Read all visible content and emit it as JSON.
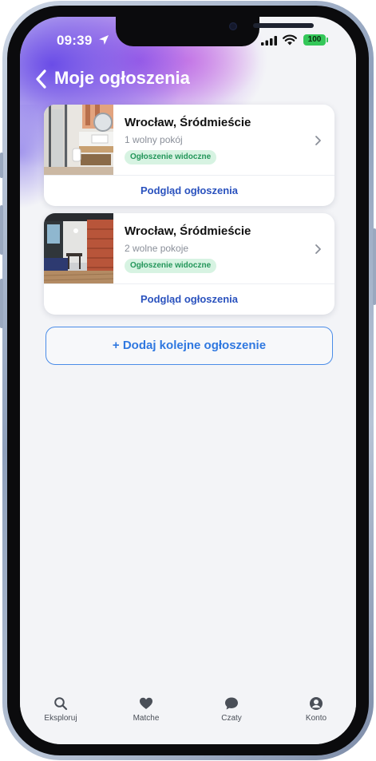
{
  "status_bar": {
    "time": "09:39",
    "battery": "100",
    "icons": [
      "location-arrow-icon",
      "signal-icon",
      "wifi-icon",
      "battery-icon"
    ]
  },
  "header": {
    "back_icon": "chevron-left-icon",
    "title": "Moje ogłoszenia"
  },
  "listings": [
    {
      "city": "Wrocław, Śródmieście",
      "rooms": "1 wolny pokój",
      "status": "Ogłoszenie widoczne",
      "preview": "Podgląd ogłoszenia"
    },
    {
      "city": "Wrocław, Śródmieście",
      "rooms": "2 wolne pokoje",
      "status": "Ogłoszenie widoczne",
      "preview": "Podgląd ogłoszenia"
    }
  ],
  "add_button": "+ Dodaj kolejne ogłoszenie",
  "tabs": [
    {
      "label": "Eksploruj",
      "icon": "search-icon"
    },
    {
      "label": "Matche",
      "icon": "heart-icon"
    },
    {
      "label": "Czaty",
      "icon": "chat-bubble-icon"
    },
    {
      "label": "Konto",
      "icon": "account-icon"
    }
  ],
  "colors": {
    "accent_blue": "#2a52be",
    "add_button_blue": "#2f78e0",
    "badge_green_bg": "#d7f3e2",
    "badge_green_text": "#23965a",
    "battery_green": "#34c759",
    "header_gradient": [
      "#6446e6",
      "#a050e6",
      "#e66edc"
    ]
  }
}
